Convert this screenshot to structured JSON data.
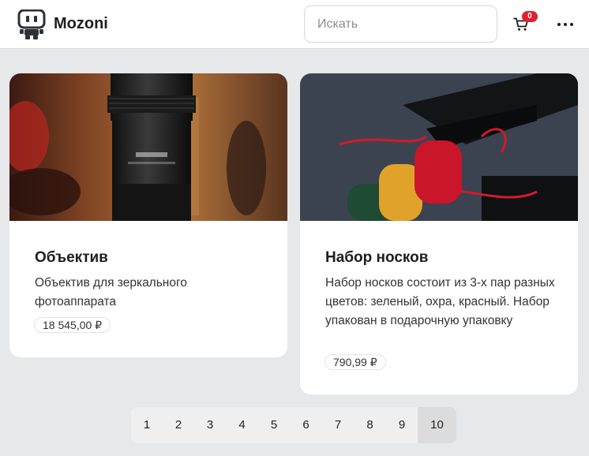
{
  "header": {
    "brand": "Mozoni",
    "search_placeholder": "Искать",
    "cart_count": "0"
  },
  "products": [
    {
      "title": "Объектив",
      "description": "Объектив для зеркального фотоаппарата",
      "price": "18 545,00 ₽"
    },
    {
      "title": "Набор носков",
      "description": "Набор носков состоит из 3-х пар разных цветов: зеленый, охра, красный. Набор упакован в подарочную упаковку",
      "price": "790,99 ₽"
    }
  ],
  "pagination": {
    "pages": [
      "1",
      "2",
      "3",
      "4",
      "5",
      "6",
      "7",
      "8",
      "9",
      "10"
    ],
    "current": "10"
  },
  "colors": {
    "background": "#e6e8ea",
    "badge": "#e0212f",
    "text": "#222222"
  },
  "icons": {
    "logo": "robot-logo-icon",
    "cart": "shopping-cart-icon",
    "more": "more-horizontal-icon"
  }
}
